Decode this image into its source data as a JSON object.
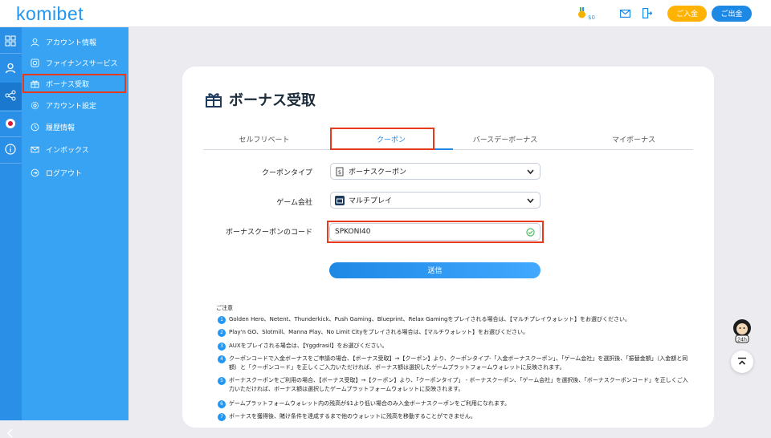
{
  "header": {
    "logo": "komibet",
    "balance": "$0",
    "deposit_label": "ご入金",
    "withdraw_label": "ご出金"
  },
  "sidebar": {
    "items": [
      {
        "label": "アカウント情報",
        "icon": "user-icon"
      },
      {
        "label": "ファイナンスサービス",
        "icon": "finance-icon"
      },
      {
        "label": "ボーナス受取",
        "icon": "gift-icon"
      },
      {
        "label": "アカウント設定",
        "icon": "gear-icon"
      },
      {
        "label": "履歴情報",
        "icon": "history-icon"
      },
      {
        "label": "インボックス",
        "icon": "mail-icon"
      },
      {
        "label": "ログアウト",
        "icon": "logout-icon"
      }
    ]
  },
  "page": {
    "title": "ボーナス受取",
    "tabs": [
      "セルフリベート",
      "クーポン",
      "バースデーボーナス",
      "マイボーナス"
    ],
    "active_tab": "クーポン",
    "form": {
      "coupon_type_label": "クーポンタイプ",
      "coupon_type_value": "ボーナスクーポン",
      "game_company_label": "ゲーム会社",
      "game_company_value": "マルチプレイ",
      "code_label": "ボーナスクーポンのコード",
      "code_value": "SPKONI40",
      "submit_label": "送信"
    },
    "notes_title": "ご注意",
    "notes": [
      "Golden Hero、Netent、Thunderkick、Push Gaming、Blueprint、Relax Gamingをプレイされる場合は、【マルチプレイウォレット】をお選びください。",
      "Play'n GO、Slotmill、Manna Play、No Limit Cityをプレイされる場合は、【マルチウォレット】をお選びください。",
      "AUXをプレイされる場合は、【Yggdrasil】をお選びください。",
      "クーポンコードで入金ボーナスをご申請の場合、【ボーナス受取】→【クーポン】より、クーポンタイプ-「入金ボーナスクーポン」、「ゲーム会社」を選択後、「振替金額」（入金額と同額）と「クーポンコード」を正しくご入力いただければ、ボーナス額は選択したゲームプラットフォームウォレットに反映されます。",
      "ボーナスクーポンをご利用の場合、【ボーナス受取】→【クーポン】より、「クーポンタイプ」 - ボーナスクーポン、「ゲーム会社」を選択後、「ボーナスクーポンコード」を正しくご入力いただければ、ボーナス額は選択したゲームプラットフォームウォレットに反映されます。",
      "ゲームプラットフォームウォレット内の残高が$1より低い場合のみ入金ボーナスクーポンをご利用になれます。",
      "ボーナスを獲得後、賭け条件を達成するまで他のウォレットに残高を移動することができません。"
    ]
  },
  "colors": {
    "primary": "#1e88e5",
    "sidebar": "#37a3f2",
    "deposit": "#ffb300",
    "highlight": "#e53a1d"
  }
}
